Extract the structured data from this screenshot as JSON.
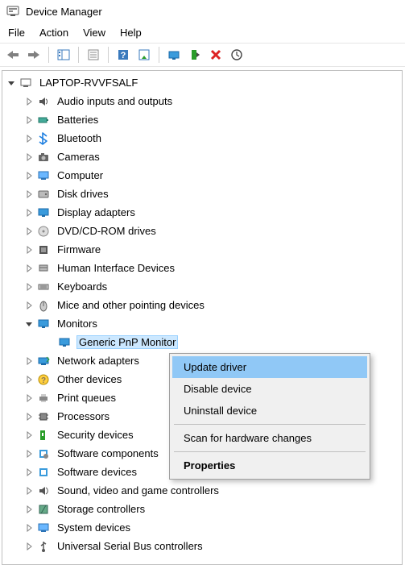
{
  "window": {
    "title": "Device Manager"
  },
  "menu": {
    "items": [
      "File",
      "Action",
      "View",
      "Help"
    ]
  },
  "toolbar": {
    "items": [
      "back-icon",
      "forward-icon",
      "sep",
      "up-icon",
      "sep",
      "properties-icon",
      "sep",
      "help-icon",
      "scan-icon",
      "sep",
      "show-hidden-icon",
      "enable-icon",
      "disable-icon",
      "uninstall-icon"
    ]
  },
  "tree": {
    "root": {
      "label": "LAPTOP-RVVFSALF",
      "expanded": true
    },
    "nodes": [
      {
        "label": "Audio inputs and outputs",
        "icon": "speaker"
      },
      {
        "label": "Batteries",
        "icon": "battery"
      },
      {
        "label": "Bluetooth",
        "icon": "bluetooth"
      },
      {
        "label": "Cameras",
        "icon": "camera"
      },
      {
        "label": "Computer",
        "icon": "computer"
      },
      {
        "label": "Disk drives",
        "icon": "disk"
      },
      {
        "label": "Display adapters",
        "icon": "display"
      },
      {
        "label": "DVD/CD-ROM drives",
        "icon": "dvd"
      },
      {
        "label": "Firmware",
        "icon": "firmware"
      },
      {
        "label": "Human Interface Devices",
        "icon": "hid"
      },
      {
        "label": "Keyboards",
        "icon": "keyboard"
      },
      {
        "label": "Mice and other pointing devices",
        "icon": "mouse"
      },
      {
        "label": "Monitors",
        "icon": "monitor",
        "expanded": true,
        "children": [
          {
            "label": "Generic PnP Monitor",
            "icon": "monitor",
            "selected": true
          }
        ]
      },
      {
        "label": "Network adapters",
        "icon": "network"
      },
      {
        "label": "Other devices",
        "icon": "other"
      },
      {
        "label": "Print queues",
        "icon": "printer"
      },
      {
        "label": "Processors",
        "icon": "cpu"
      },
      {
        "label": "Security devices",
        "icon": "security"
      },
      {
        "label": "Software components",
        "icon": "swcomp"
      },
      {
        "label": "Software devices",
        "icon": "swdev"
      },
      {
        "label": "Sound, video and game controllers",
        "icon": "sound"
      },
      {
        "label": "Storage controllers",
        "icon": "storage"
      },
      {
        "label": "System devices",
        "icon": "system"
      },
      {
        "label": "Universal Serial Bus controllers",
        "icon": "usb"
      }
    ]
  },
  "context_menu": {
    "items": [
      {
        "label": "Update driver",
        "highlight": true
      },
      {
        "label": "Disable device"
      },
      {
        "label": "Uninstall device"
      },
      {
        "sep": true
      },
      {
        "label": "Scan for hardware changes"
      },
      {
        "sep": true
      },
      {
        "label": "Properties",
        "bold": true
      }
    ]
  }
}
